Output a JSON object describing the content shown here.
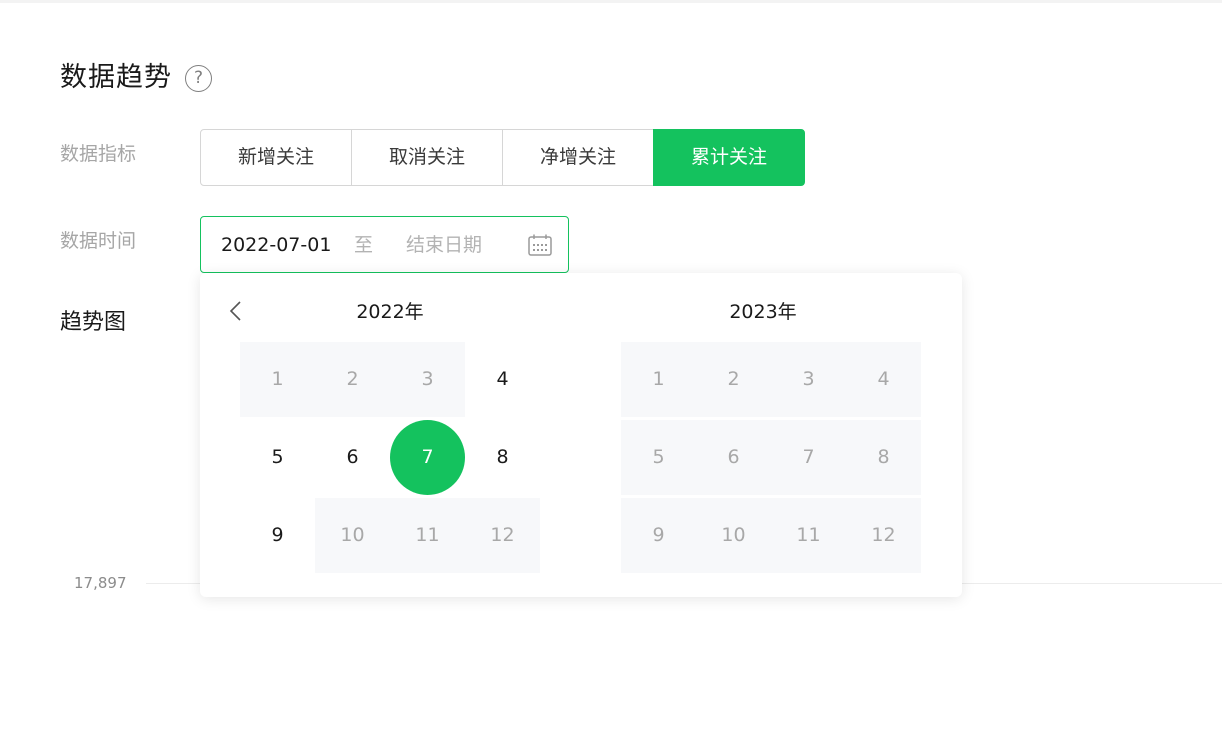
{
  "header": {
    "title": "数据趋势",
    "help_glyph": "?"
  },
  "filters": {
    "metric_label": "数据指标",
    "metrics": [
      "新增关注",
      "取消关注",
      "净增关注",
      "累计关注"
    ],
    "active_metric_index": 3,
    "time_label": "数据时间",
    "start_date": "2022-07-01",
    "separator": "至",
    "end_placeholder": "结束日期"
  },
  "chart": {
    "title": "趋势图",
    "y_tick": "17,897"
  },
  "picker": {
    "left": {
      "year": "2022年",
      "months": [
        {
          "label": "1",
          "state": "disabled"
        },
        {
          "label": "2",
          "state": "disabled"
        },
        {
          "label": "3",
          "state": "disabled"
        },
        {
          "label": "4",
          "state": "enabled"
        },
        {
          "label": "5",
          "state": "enabled"
        },
        {
          "label": "6",
          "state": "enabled"
        },
        {
          "label": "7",
          "state": "selected"
        },
        {
          "label": "8",
          "state": "enabled"
        },
        {
          "label": "9",
          "state": "enabled"
        },
        {
          "label": "10",
          "state": "disabled"
        },
        {
          "label": "11",
          "state": "disabled"
        },
        {
          "label": "12",
          "state": "disabled"
        }
      ]
    },
    "right": {
      "year": "2023年",
      "months": [
        {
          "label": "1",
          "state": "disabled"
        },
        {
          "label": "2",
          "state": "disabled"
        },
        {
          "label": "3",
          "state": "disabled"
        },
        {
          "label": "4",
          "state": "disabled"
        },
        {
          "label": "5",
          "state": "disabled"
        },
        {
          "label": "6",
          "state": "disabled"
        },
        {
          "label": "7",
          "state": "disabled"
        },
        {
          "label": "8",
          "state": "disabled"
        },
        {
          "label": "9",
          "state": "disabled"
        },
        {
          "label": "10",
          "state": "disabled"
        },
        {
          "label": "11",
          "state": "disabled"
        },
        {
          "label": "12",
          "state": "disabled"
        }
      ]
    }
  },
  "colors": {
    "accent": "#14c25e",
    "disabled_bg": "#f7f8fa"
  },
  "icons": {
    "help": "question-circle-icon",
    "calendar": "calendar-icon",
    "prev": "chevron-left-icon"
  }
}
